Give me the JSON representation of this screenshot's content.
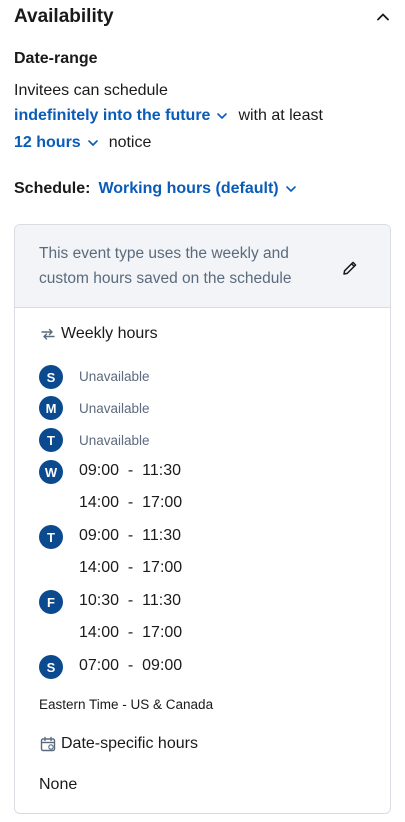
{
  "availability": {
    "title": "Availability",
    "collapse_icon": "chevron-up-icon"
  },
  "date_range": {
    "title": "Date-range",
    "intro": "Invitees can schedule",
    "range_value": "indefinitely into the future",
    "range_suffix": "with at least",
    "notice_value": "12 hours",
    "notice_suffix": "notice"
  },
  "schedule": {
    "label": "Schedule:",
    "value": "Working hours (default)"
  },
  "card": {
    "notice_line1": "This event type uses the weekly and",
    "notice_line2": "custom hours saved on the schedule",
    "edit_icon": "pencil-icon",
    "weekly_title": "Weekly hours",
    "weekly_icon": "repeat-icon",
    "days": [
      {
        "letter": "S",
        "status": "Unavailable"
      },
      {
        "letter": "M",
        "status": "Unavailable"
      },
      {
        "letter": "T",
        "status": "Unavailable"
      },
      {
        "letter": "W",
        "ranges": [
          "09:00  -  11:30",
          "14:00  -  17:00"
        ]
      },
      {
        "letter": "T",
        "ranges": [
          "09:00  -  11:30",
          "14:00  -  17:00"
        ]
      },
      {
        "letter": "F",
        "ranges": [
          "10:30  -  11:30",
          "14:00  -  17:00"
        ]
      },
      {
        "letter": "S",
        "ranges": [
          "07:00  -  09:00"
        ]
      }
    ],
    "timezone": "Eastern Time - US & Canada",
    "date_specific_title": "Date-specific hours",
    "date_specific_icon": "calendar-icon",
    "date_specific_value": "None"
  },
  "colors": {
    "link": "#0a5cb8",
    "badge": "#0b4a8f",
    "muted": "#5a6b7d",
    "notice_bg": "#f2f4f7",
    "border": "#d9dde3"
  }
}
